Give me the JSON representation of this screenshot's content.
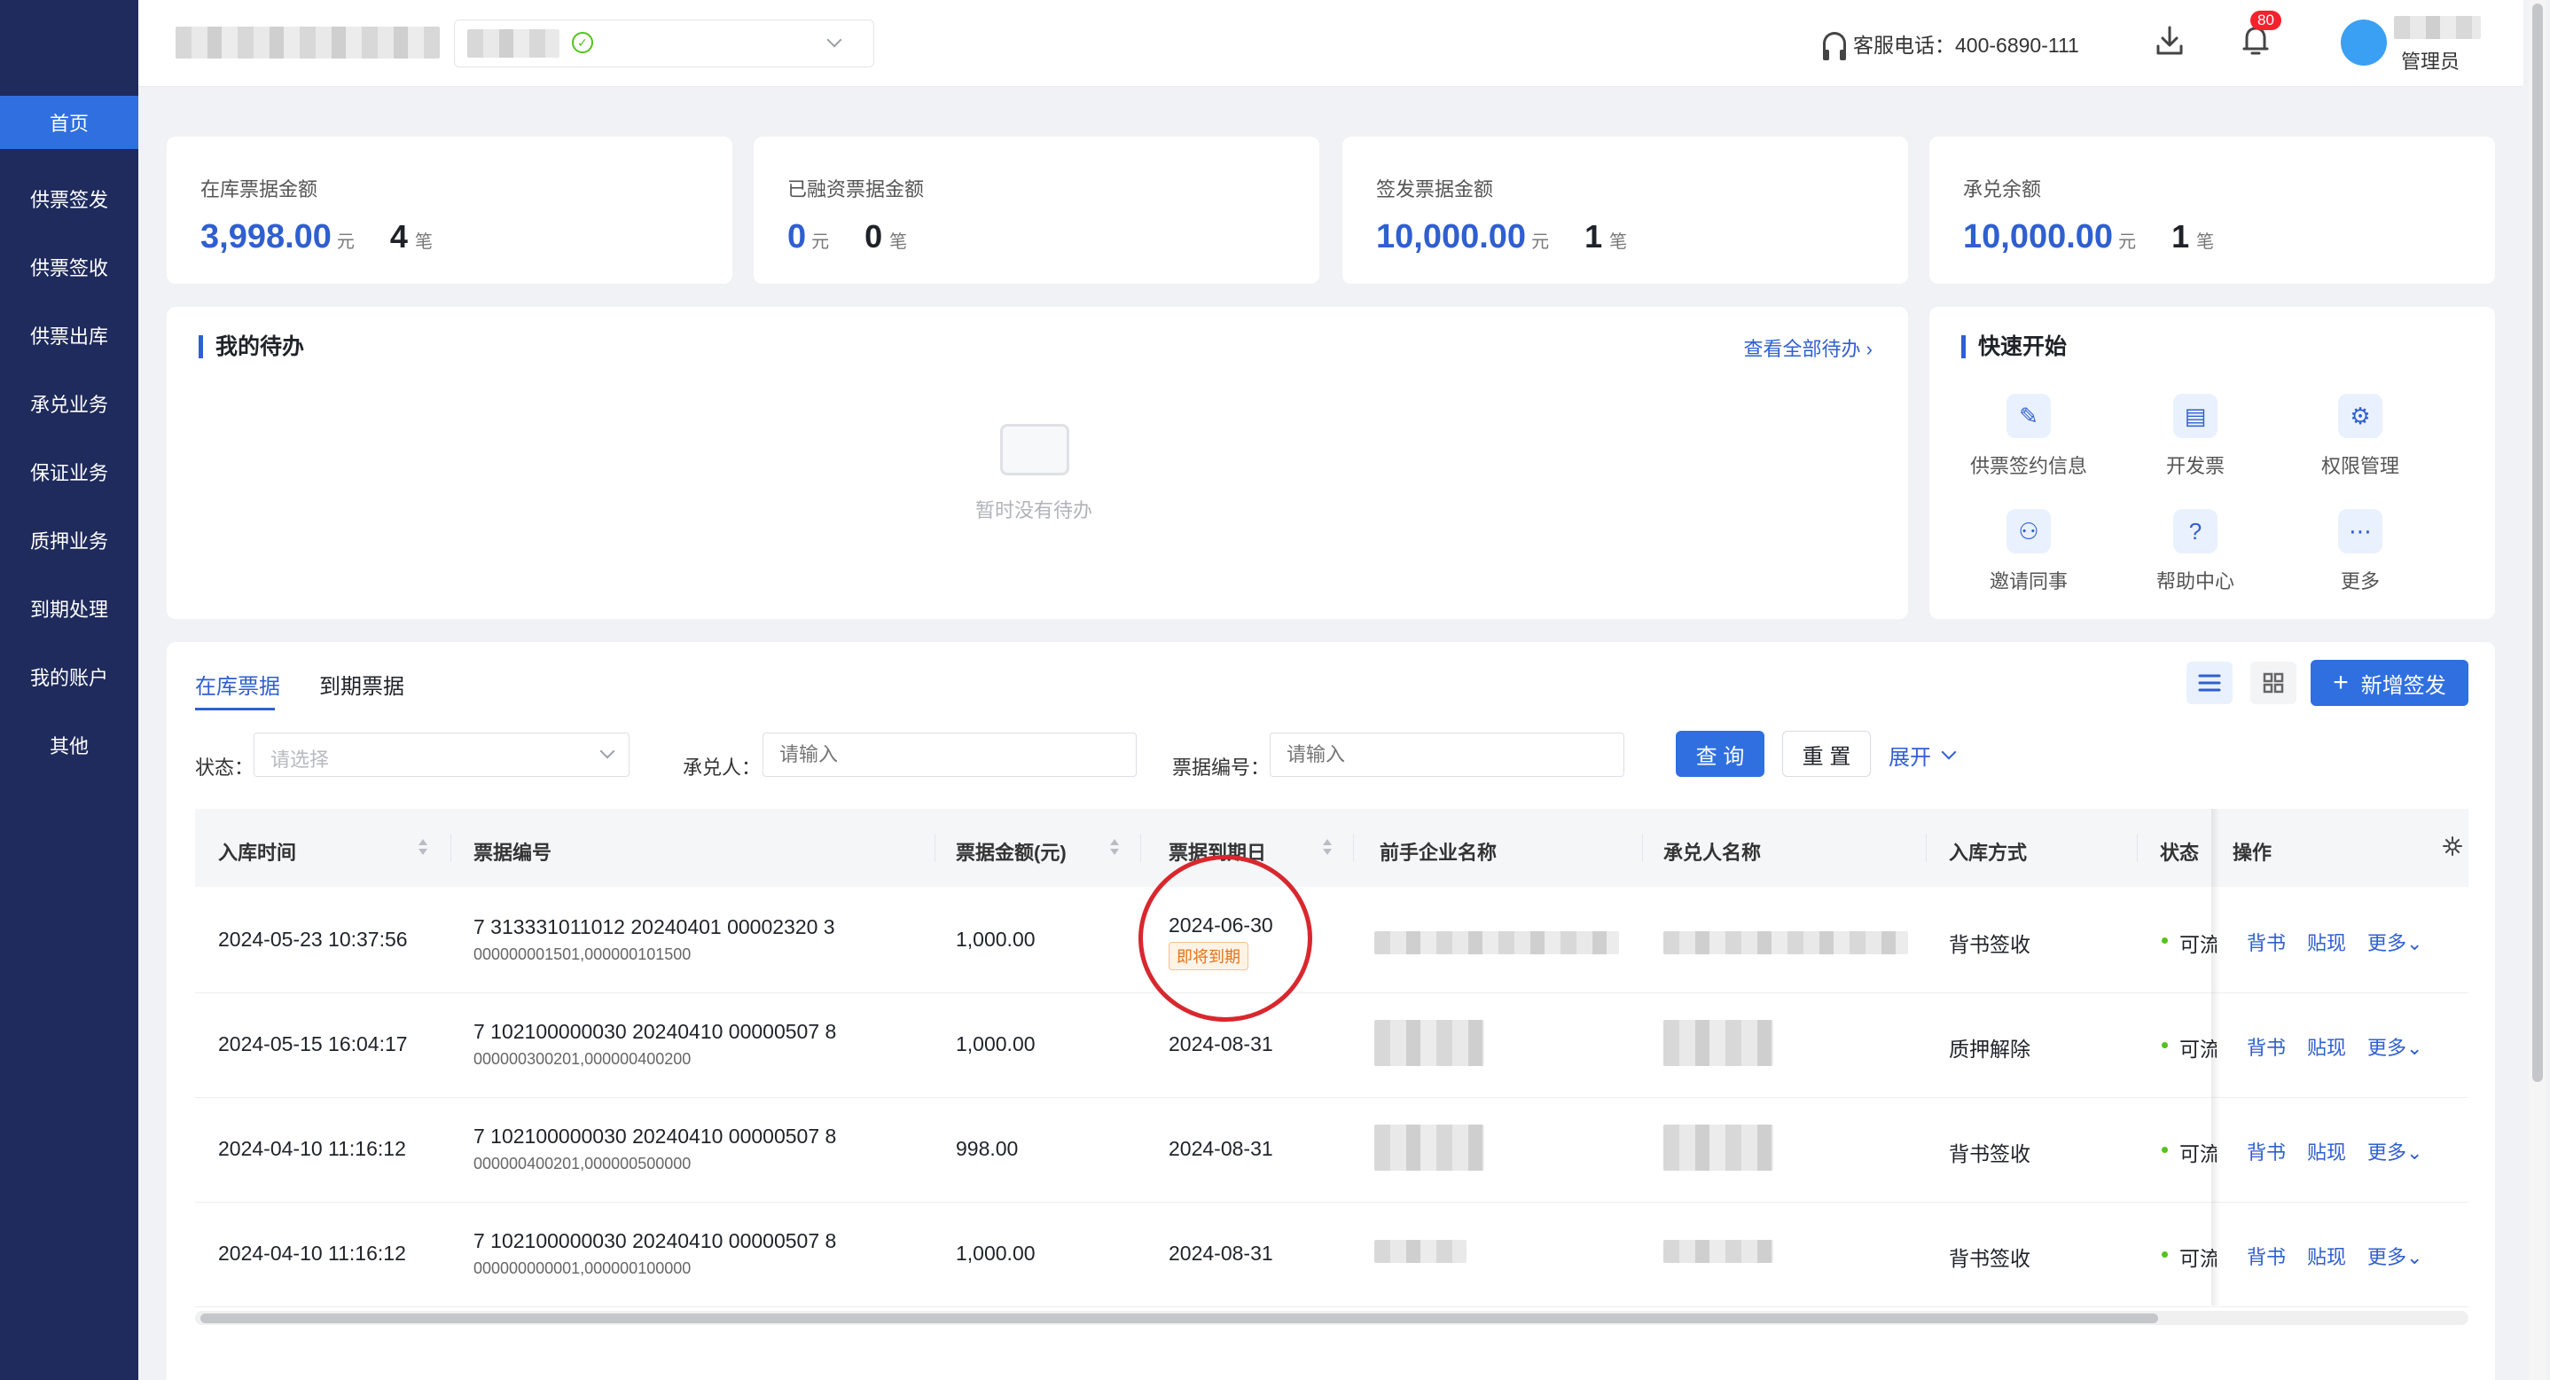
{
  "sidebar": {
    "items": [
      {
        "label": "首页"
      },
      {
        "label": "供票签发"
      },
      {
        "label": "供票签收"
      },
      {
        "label": "供票出库"
      },
      {
        "label": "承兑业务"
      },
      {
        "label": "保证业务"
      },
      {
        "label": "质押业务"
      },
      {
        "label": "到期处理"
      },
      {
        "label": "我的账户"
      },
      {
        "label": "其他"
      }
    ],
    "active_index": 0
  },
  "header": {
    "hotline": "客服电话：400-6890-111",
    "notification_count": "80",
    "user_role": "管理员"
  },
  "stats": [
    {
      "label": "在库票据金额",
      "amount": "3,998.00",
      "amount_unit": "元",
      "count": "4",
      "count_unit": "笔"
    },
    {
      "label": "已融资票据金额",
      "amount": "0",
      "amount_unit": "元",
      "count": "0",
      "count_unit": "笔"
    },
    {
      "label": "签发票据金额",
      "amount": "10,000.00",
      "amount_unit": "元",
      "count": "1",
      "count_unit": "笔"
    },
    {
      "label": "承兑余额",
      "amount": "10,000.00",
      "amount_unit": "元",
      "count": "1",
      "count_unit": "笔"
    }
  ],
  "todo": {
    "title": "我的待办",
    "view_all": "查看全部待办",
    "empty_text": "暂时没有待办"
  },
  "quick_start": {
    "title": "快速开始",
    "items": [
      {
        "label": "供票签约信息",
        "icon": "contract-icon"
      },
      {
        "label": "开发票",
        "icon": "invoice-icon"
      },
      {
        "label": "权限管理",
        "icon": "gear-icon"
      },
      {
        "label": "邀请同事",
        "icon": "invite-user-icon"
      },
      {
        "label": "帮助中心",
        "icon": "help-icon"
      },
      {
        "label": "更多",
        "icon": "more-icon"
      }
    ]
  },
  "bills": {
    "tabs": [
      {
        "label": "在库票据"
      },
      {
        "label": "到期票据"
      }
    ],
    "active_tab": 0,
    "new_button": "新增签发",
    "filters": {
      "status_label": "状态：",
      "status_placeholder": "请选择",
      "acceptor_label": "承兑人：",
      "acceptor_placeholder": "请输入",
      "bill_no_label": "票据编号：",
      "bill_no_placeholder": "请输入",
      "query_button": "查 询",
      "reset_button": "重 置",
      "expand_link": "展开"
    },
    "columns": [
      "入库时间",
      "票据编号",
      "票据金额(元)",
      "票据到期日",
      "前手企业名称",
      "承兑人名称",
      "入库方式",
      "状态",
      "操作"
    ],
    "rows": [
      {
        "time": "2024-05-23 10:37:56",
        "bill_no": "7 313331011012 20240401 00002320 3",
        "sub_no": "000000001501,000000101500",
        "amount": "1,000.00",
        "due": "2024-06-30",
        "due_tag": "即将到期",
        "method": "背书签收",
        "status": "可流"
      },
      {
        "time": "2024-05-15 16:04:17",
        "bill_no": "7 102100000030 20240410 00000507 8",
        "sub_no": "000000300201,000000400200",
        "amount": "1,000.00",
        "due": "2024-08-31",
        "due_tag": "",
        "method": "质押解除",
        "status": "可流"
      },
      {
        "time": "2024-04-10 11:16:12",
        "bill_no": "7 102100000030 20240410 00000507 8",
        "sub_no": "000000400201,000000500000",
        "amount": "998.00",
        "due": "2024-08-31",
        "due_tag": "",
        "method": "背书签收",
        "status": "可流"
      },
      {
        "time": "2024-04-10 11:16:12",
        "bill_no": "7 102100000030 20240410 00000507 8",
        "sub_no": "000000000001,000000100000",
        "amount": "1,000.00",
        "due": "2024-08-31",
        "due_tag": "",
        "method": "背书签收",
        "status": "可流"
      }
    ],
    "actions": {
      "endorse": "背书",
      "discount": "贴现",
      "more": "更多"
    }
  },
  "colors": {
    "sidebar_bg": "#1f2b5c",
    "accent": "#2f6fe0",
    "warning": "#e37318",
    "annotation_circle": "#d9272e"
  }
}
